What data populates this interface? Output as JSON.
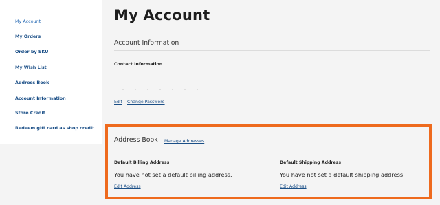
{
  "sidebar": {
    "items": [
      {
        "label": "My Account"
      },
      {
        "label": "My Orders"
      },
      {
        "label": "Order by SKU"
      },
      {
        "label": "My Wish List"
      },
      {
        "label": "Address Book"
      },
      {
        "label": "Account Information"
      },
      {
        "label": "Store Credit"
      },
      {
        "label": "Redeem gift card as shop credit"
      }
    ]
  },
  "page": {
    "title": "My Account"
  },
  "account_info": {
    "section_title": "Account Information",
    "contact_label": "Contact Information",
    "edit_label": "Edit",
    "change_password_label": "Change Password"
  },
  "address_book": {
    "section_title": "Address Book",
    "manage_label": "Manage Addresses",
    "billing": {
      "label": "Default Billing Address",
      "text": "You have not set a default billing address.",
      "edit_label": "Edit Address"
    },
    "shipping": {
      "label": "Default Shipping Address",
      "text": "You have not set a default shipping address.",
      "edit_label": "Edit Address"
    }
  },
  "colors": {
    "accent_link": "#1b4f87",
    "highlight_border": "#ee6a1d",
    "page_background": "#f4f4f4"
  }
}
